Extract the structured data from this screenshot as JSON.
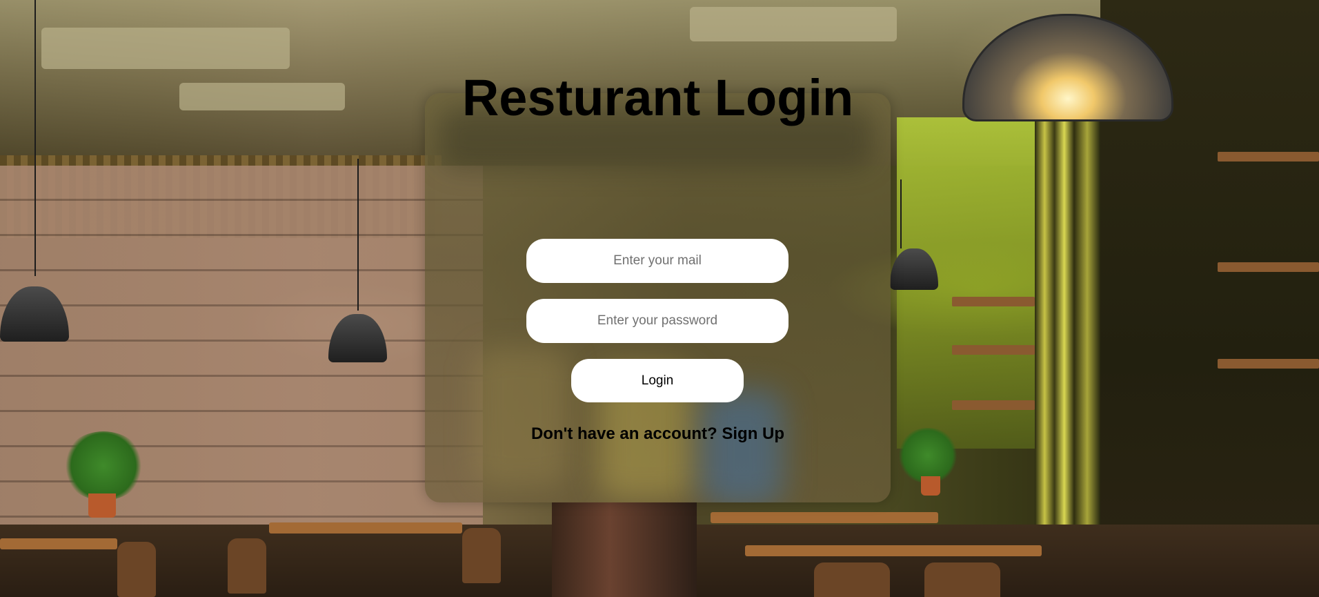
{
  "login": {
    "title": "Resturant Login",
    "email_placeholder": "Enter your mail",
    "password_placeholder": "Enter your password",
    "login_label": "Login",
    "signup_prompt": "Don't have an account? ",
    "signup_link": "Sign Up"
  },
  "theme": {
    "card_color": "#6e643c",
    "input_background": "#ffffff",
    "text_color": "#000000"
  }
}
